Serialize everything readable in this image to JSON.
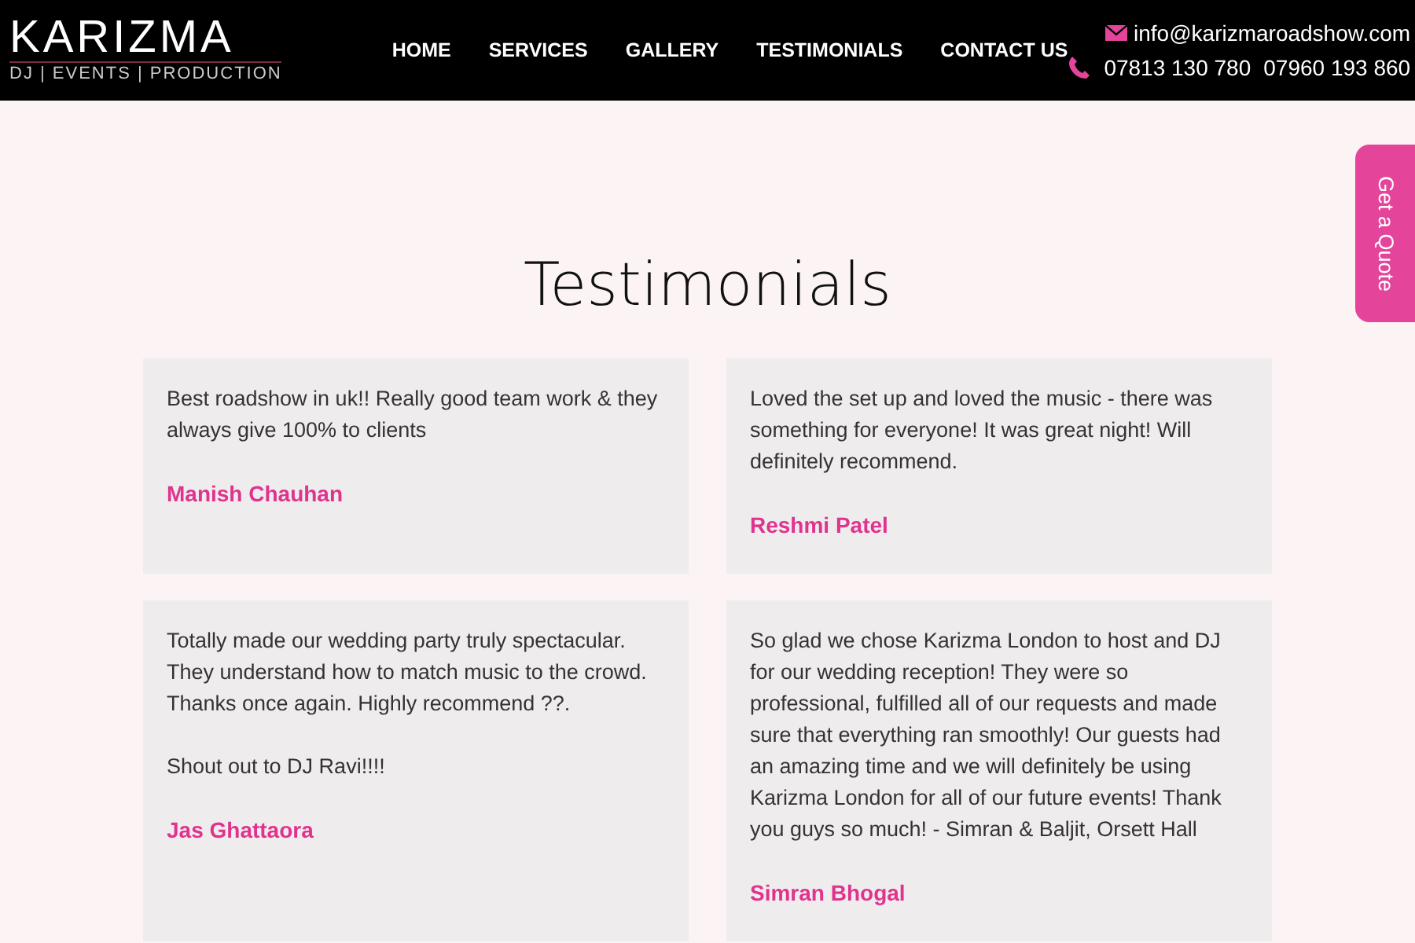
{
  "header": {
    "logo": {
      "name": "KARIZMA",
      "tagline": "DJ | EVENTS | PRODUCTION"
    },
    "nav": [
      "HOME",
      "SERVICES",
      "GALLERY",
      "TESTIMONIALS",
      "CONTACT US"
    ],
    "email": "info@karizmaroadshow.com",
    "phones": [
      "07813 130 780",
      "07960 193 860"
    ]
  },
  "quote_tab": "Get a Quote",
  "title": "Testimonials",
  "testimonials": [
    {
      "paragraphs": [
        "Best roadshow in uk!! Really good team work & they always give 100% to clients"
      ],
      "author": "Manish Chauhan"
    },
    {
      "paragraphs": [
        "Loved the set up and loved the music - there was something for everyone! It was great night! Will definitely recommend."
      ],
      "author": "Reshmi Patel"
    },
    {
      "paragraphs": [
        "Totally made our wedding party truly spectacular. They understand how to match music to the crowd. Thanks once again. Highly recommend ??.",
        "Shout out to DJ Ravi!!!!"
      ],
      "author": "Jas Ghattaora"
    },
    {
      "paragraphs": [
        "So glad we chose Karizma London to host and DJ for our wedding reception! They were so professional, fulfilled all of our requests and made sure that everything ran smoothly! Our guests had an amazing time and we will definitely be using Karizma London for all of our future events! Thank you guys so much! - Simran & Baljit, Orsett Hall"
      ],
      "author": "Simran Bhogal"
    }
  ]
}
